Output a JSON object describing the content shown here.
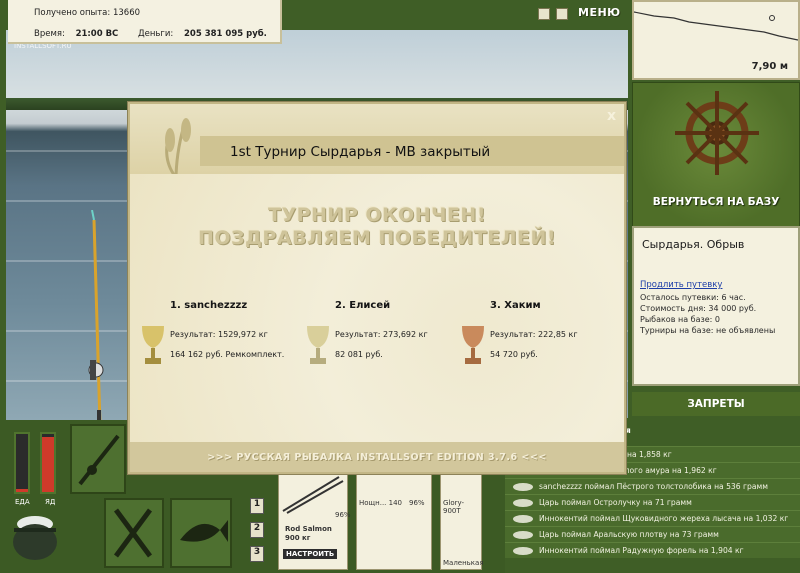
{
  "stats": {
    "exp_label": "Получено опыта:",
    "exp_value": "13660",
    "time_label": "Время:",
    "time_value": "21:00 ВС",
    "money_label": "Деньги:",
    "money_value": "205 381 095 руб."
  },
  "watermark": "INSTALLSOFT.RU",
  "topbar": {
    "menu_label": "МЕНЮ"
  },
  "map": {
    "depth": "7,90 м"
  },
  "right_panel": {
    "return_label": "ВЕРНУТЬСЯ НА БАЗУ",
    "base_name": "Сырдарья. Обрыв",
    "buy_link": "Продлить путевку",
    "lines": [
      "Осталось путевки: 6 час.",
      "Стоимость дня: 34 000 руб.",
      "Рыбаков на базе: 0",
      "Турниры на базе: не объявлены"
    ],
    "bans_label": "ЗАПРЕТЫ"
  },
  "catch_log": [
    "я на 1,858 кг",
    "елого амура на 1,962 кг",
    "sanchezzzz поймал Пёстрого толстолобика на 536 грамм",
    "Царь поймал Остролучку на 71 грамм",
    "Иннокентий поймал Щуковидного жереха лысача на 1,032 кг",
    "Царь поймал Аральскую плотву на 73 грамм",
    "Иннокентий поймал Радужную форель на 1,904 кг"
  ],
  "log_header_fragment": "ия",
  "bottom": {
    "meter_food_label": "ЕДА",
    "meter_poison_label": "ЯД",
    "food_level": 0.05,
    "poison_level": 0.95,
    "slot_numbers": [
      "1",
      "2",
      "3"
    ],
    "rod_name": "Rod Salmon",
    "rod_weight": "900 кг",
    "setup_label": "НАСТРОИТЬ",
    "pct1": "96%",
    "pct2": "96%",
    "reel_caption": "Нощн... 140",
    "lure_caption": "Glory-900T",
    "bait_caption": "Маленькая"
  },
  "dialog": {
    "title": "1st Турнир Сырдарья - МВ закрытый",
    "close": "x",
    "headline1": "ТУРНИР ОКОНЧЕН!",
    "headline2": "ПОЗДРАВЛЯЕМ ПОБЕДИТЕЛЕЙ!",
    "winners": [
      {
        "name": "1. sanchezzzz",
        "result": "Результат: 1529,972 кг",
        "money": "164 162 руб. Ремкомплект.",
        "medal": "#d8c26a"
      },
      {
        "name": "2. Елисей",
        "result": "Результат: 273,692 кг",
        "money": "82 081 руб.",
        "medal": "#d9cf9a"
      },
      {
        "name": "3. Хаким",
        "result": "Результат: 222,85 кг",
        "money": "54 720 руб.",
        "medal": "#c98a5c"
      }
    ],
    "version": ">>> РУССКАЯ РЫБАЛКА INSTALLSOFT EDITION 3.7.6 <<<"
  }
}
